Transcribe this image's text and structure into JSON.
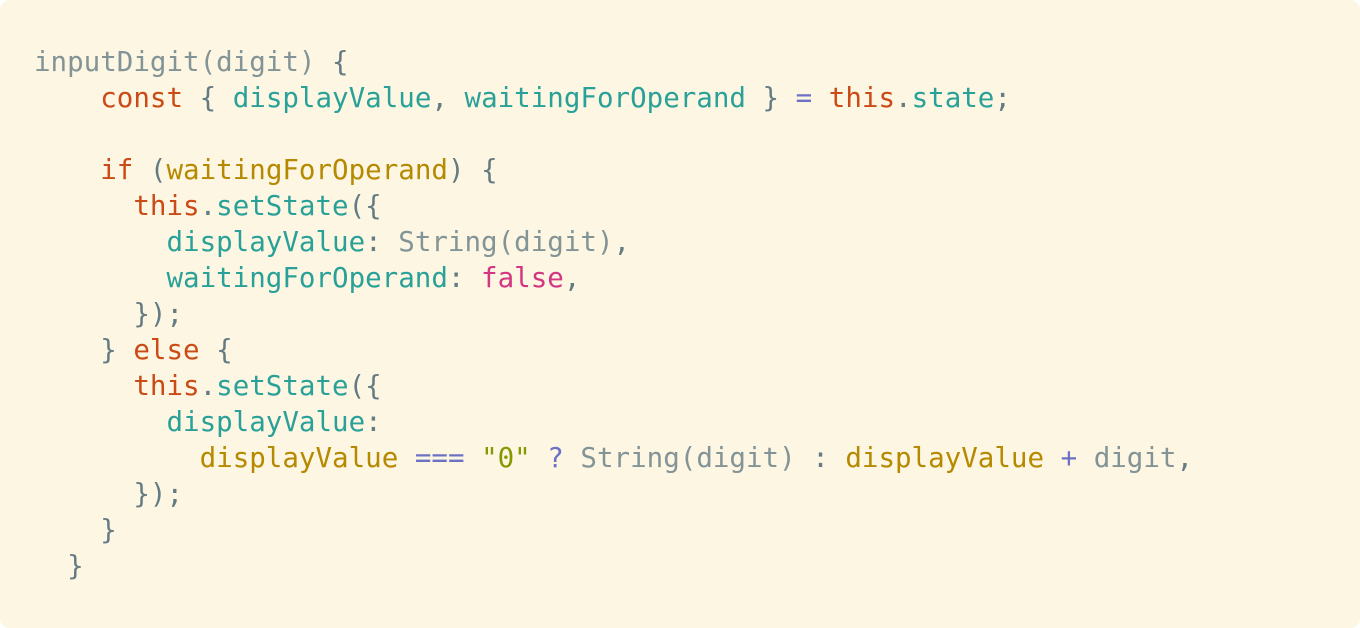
{
  "editor": {
    "background": "#fdf6e3",
    "theme_colors": {
      "plain": "#839496",
      "punct": "#657b83",
      "keyword": "#cb4b16",
      "prop": "#2aa198",
      "ident": "#b58900",
      "op": "#6c71c4",
      "bool": "#d33682",
      "string": "#859900"
    },
    "lines": [
      [
        {
          "t": "inputDigit(digit) ",
          "k": "plain"
        },
        {
          "t": "{",
          "k": "punct"
        }
      ],
      [
        {
          "t": "    ",
          "k": "plain"
        },
        {
          "t": "const",
          "k": "keyword"
        },
        {
          "t": " { ",
          "k": "punct"
        },
        {
          "t": "displayValue",
          "k": "prop"
        },
        {
          "t": ", ",
          "k": "punct"
        },
        {
          "t": "waitingForOperand",
          "k": "prop"
        },
        {
          "t": " } ",
          "k": "punct"
        },
        {
          "t": "=",
          "k": "op"
        },
        {
          "t": " ",
          "k": "plain"
        },
        {
          "t": "this",
          "k": "keyword"
        },
        {
          "t": ".",
          "k": "punct"
        },
        {
          "t": "state",
          "k": "prop"
        },
        {
          "t": ";",
          "k": "punct"
        }
      ],
      [],
      [
        {
          "t": "    ",
          "k": "plain"
        },
        {
          "t": "if",
          "k": "keyword"
        },
        {
          "t": " (",
          "k": "punct"
        },
        {
          "t": "waitingForOperand",
          "k": "ident"
        },
        {
          "t": ") {",
          "k": "punct"
        }
      ],
      [
        {
          "t": "      ",
          "k": "plain"
        },
        {
          "t": "this",
          "k": "keyword"
        },
        {
          "t": ".",
          "k": "punct"
        },
        {
          "t": "setState",
          "k": "prop"
        },
        {
          "t": "({",
          "k": "punct"
        }
      ],
      [
        {
          "t": "        ",
          "k": "plain"
        },
        {
          "t": "displayValue",
          "k": "prop"
        },
        {
          "t": ": ",
          "k": "punct"
        },
        {
          "t": "String(digit)",
          "k": "plain"
        },
        {
          "t": ",",
          "k": "punct"
        }
      ],
      [
        {
          "t": "        ",
          "k": "plain"
        },
        {
          "t": "waitingForOperand",
          "k": "prop"
        },
        {
          "t": ": ",
          "k": "punct"
        },
        {
          "t": "false",
          "k": "bool"
        },
        {
          "t": ",",
          "k": "punct"
        }
      ],
      [
        {
          "t": "      ",
          "k": "plain"
        },
        {
          "t": "});",
          "k": "punct"
        }
      ],
      [
        {
          "t": "    ",
          "k": "plain"
        },
        {
          "t": "} ",
          "k": "punct"
        },
        {
          "t": "else",
          "k": "keyword"
        },
        {
          "t": " {",
          "k": "punct"
        }
      ],
      [
        {
          "t": "      ",
          "k": "plain"
        },
        {
          "t": "this",
          "k": "keyword"
        },
        {
          "t": ".",
          "k": "punct"
        },
        {
          "t": "setState",
          "k": "prop"
        },
        {
          "t": "({",
          "k": "punct"
        }
      ],
      [
        {
          "t": "        ",
          "k": "plain"
        },
        {
          "t": "displayValue",
          "k": "prop"
        },
        {
          "t": ":",
          "k": "punct"
        }
      ],
      [
        {
          "t": "          ",
          "k": "plain"
        },
        {
          "t": "displayValue",
          "k": "ident"
        },
        {
          "t": " ",
          "k": "plain"
        },
        {
          "t": "===",
          "k": "op"
        },
        {
          "t": " ",
          "k": "plain"
        },
        {
          "t": "\"0\"",
          "k": "string"
        },
        {
          "t": " ",
          "k": "plain"
        },
        {
          "t": "?",
          "k": "op"
        },
        {
          "t": " ",
          "k": "plain"
        },
        {
          "t": "String(digit)",
          "k": "plain"
        },
        {
          "t": " : ",
          "k": "punct"
        },
        {
          "t": "displayValue",
          "k": "ident"
        },
        {
          "t": " ",
          "k": "plain"
        },
        {
          "t": "+",
          "k": "op"
        },
        {
          "t": " digit",
          "k": "plain"
        },
        {
          "t": ",",
          "k": "punct"
        }
      ],
      [
        {
          "t": "      ",
          "k": "plain"
        },
        {
          "t": "});",
          "k": "punct"
        }
      ],
      [
        {
          "t": "    ",
          "k": "plain"
        },
        {
          "t": "}",
          "k": "punct"
        }
      ],
      [
        {
          "t": "  ",
          "k": "plain"
        },
        {
          "t": "}",
          "k": "punct"
        }
      ]
    ]
  }
}
